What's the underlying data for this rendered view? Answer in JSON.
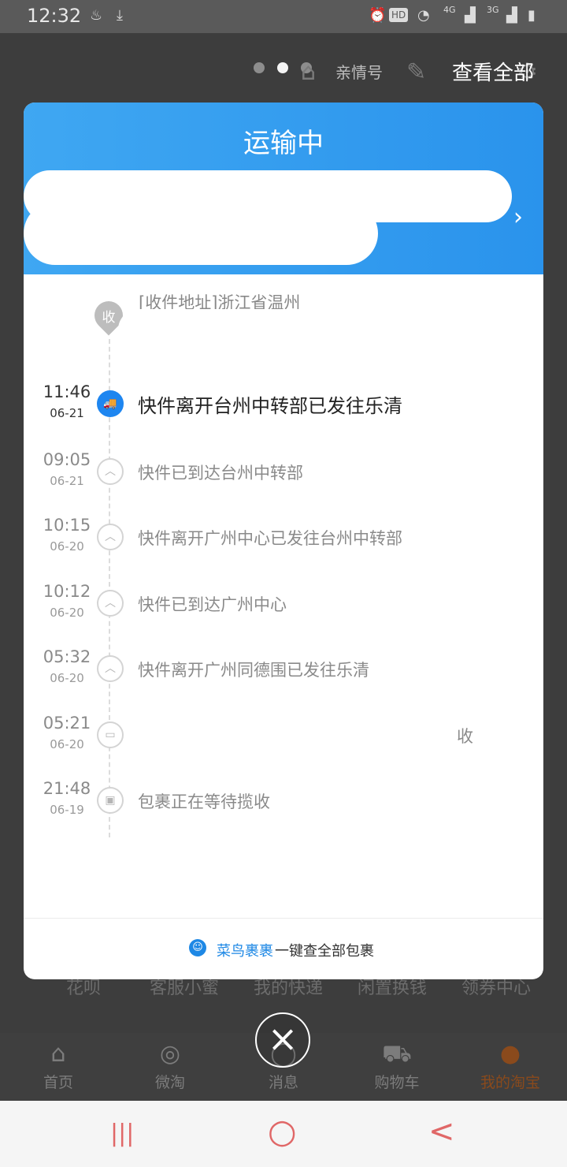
{
  "status_bar": {
    "time": "12:32",
    "icons": [
      "notification-icon",
      "download-icon",
      "alarm-icon",
      "hd-icon",
      "wifi-icon",
      "signal-4g-icon",
      "signal-3g-icon",
      "battery-icon"
    ],
    "hd": "HD",
    "net1": "4G",
    "net2": "3G"
  },
  "background": {
    "family_label": "亲情号",
    "view_all": "查看全部",
    "service_strip": [
      "花呗",
      "客服小蜜",
      "我的快递",
      "闲置换钱",
      "领券中心"
    ],
    "tabs": [
      {
        "label": "首页",
        "icon": "home-icon"
      },
      {
        "label": "微淘",
        "icon": "weitao-icon"
      },
      {
        "label": "消息",
        "icon": "message-icon"
      },
      {
        "label": "购物车",
        "icon": "cart-icon"
      },
      {
        "label": "我的淘宝",
        "icon": "user-icon"
      }
    ],
    "accent_color": "#ff5000"
  },
  "modal": {
    "title": "运输中",
    "address_label": "[收件地址]浙江省温州",
    "address_badge": "收",
    "events": [
      {
        "time": "11:46",
        "date": "06-21",
        "text": "快件离开台州中转部已发往乐清",
        "icon": "truck-icon",
        "symbol": "🚚"
      },
      {
        "time": "09:05",
        "date": "06-21",
        "text": "快件已到达台州中转部",
        "icon": "chevron-up-icon",
        "symbol": "︿"
      },
      {
        "time": "10:15",
        "date": "06-20",
        "text": "快件离开广州中心已发往台州中转部",
        "icon": "chevron-up-icon",
        "symbol": "︿"
      },
      {
        "time": "10:12",
        "date": "06-20",
        "text": "快件已到达广州中心",
        "icon": "chevron-up-icon",
        "symbol": "︿"
      },
      {
        "time": "05:32",
        "date": "06-20",
        "text": "快件离开广州同德围已发往乐清",
        "icon": "chevron-up-icon",
        "symbol": "︿"
      },
      {
        "time": "05:21",
        "date": "06-20",
        "text": "收",
        "icon": "truck-small-icon",
        "symbol": "▭"
      },
      {
        "time": "21:48",
        "date": "06-19",
        "text": "包裹正在等待揽收",
        "icon": "package-icon",
        "symbol": "▣"
      }
    ],
    "footer": {
      "brand": "菜鸟裹裹",
      "text": "一键查全部包裹"
    },
    "header_color": "#2d96ee"
  },
  "close_symbol": "×",
  "nav_bar": {
    "recent": "|||",
    "home": "○",
    "back": "<"
  }
}
